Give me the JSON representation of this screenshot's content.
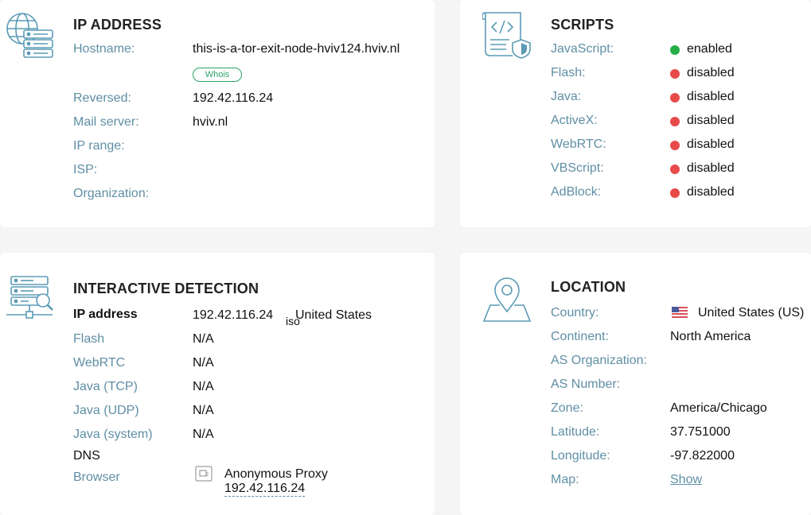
{
  "ip_address": {
    "title": "IP ADDRESS",
    "hostname_label": "Hostname:",
    "hostname_value": "this-is-a-tor-exit-node-hviv124.hviv.nl",
    "whois_button": "Whois",
    "reversed_label": "Reversed:",
    "reversed_value": "192.42.116.24",
    "mail_label": "Mail server:",
    "mail_value": "hviv.nl",
    "range_label": "IP range:",
    "isp_label": "ISP:",
    "org_label": "Organization:"
  },
  "scripts": {
    "title": "SCRIPTS",
    "items": [
      {
        "label": "JavaScript:",
        "status": "enabled",
        "color": "#27ae48"
      },
      {
        "label": "Flash:",
        "status": "disabled",
        "color": "#e84a4a"
      },
      {
        "label": "Java:",
        "status": "disabled",
        "color": "#e84a4a"
      },
      {
        "label": "ActiveX:",
        "status": "disabled",
        "color": "#e84a4a"
      },
      {
        "label": "WebRTC:",
        "status": "disabled",
        "color": "#e84a4a"
      },
      {
        "label": "VBScript:",
        "status": "disabled",
        "color": "#e84a4a"
      },
      {
        "label": "AdBlock:",
        "status": "disabled",
        "color": "#e84a4a"
      }
    ]
  },
  "interactive": {
    "title": "INTERACTIVE DETECTION",
    "ip_label": "IP address",
    "ip_value": "192.42.116.24",
    "iso_text": "iso",
    "ip_country": "United States",
    "flash_label": "Flash",
    "flash_value": "N/A",
    "webrtc_label": "WebRTC",
    "webrtc_value": "N/A",
    "java_tcp_label": "Java (TCP)",
    "java_tcp_value": "N/A",
    "java_udp_label": "Java (UDP)",
    "java_udp_value": "N/A",
    "java_sys_label": "Java (system)",
    "java_sys_value": "N/A",
    "dns_label": "DNS",
    "browser_label": "Browser",
    "browser_value": "Anonymous Proxy",
    "browser_ip": "192.42.116.24"
  },
  "location": {
    "title": "LOCATION",
    "country_label": "Country:",
    "country_value": "United States (US)",
    "continent_label": "Continent:",
    "continent_value": "North America",
    "as_org_label": "AS Organization:",
    "as_num_label": "AS Number:",
    "zone_label": "Zone:",
    "zone_value": "America/Chicago",
    "lat_label": "Latitude:",
    "lat_value": "37.751000",
    "lon_label": "Longitude:",
    "lon_value": "-97.822000",
    "map_label": "Map:",
    "map_link": "Show"
  },
  "colors": {
    "label": "#5f8fa5",
    "icon": "#5b9bb5",
    "enabled": "#27ae48",
    "disabled": "#e84a4a",
    "whois": "#2aa36a"
  }
}
